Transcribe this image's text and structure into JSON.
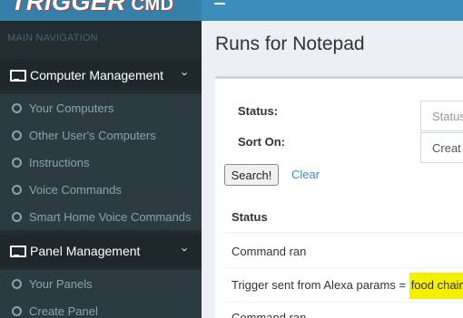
{
  "logo": {
    "text": "TRIGGER",
    "suffix": "CMD"
  },
  "sidebar": {
    "header": "MAIN NAVIGATION",
    "sections": [
      {
        "label": "Computer Management",
        "items": [
          "Your Computers",
          "Other User's Computers",
          "Instructions",
          "Voice Commands",
          "Smart Home Voice Commands"
        ]
      },
      {
        "label": "Panel Management",
        "items": [
          "Your Panels",
          "Create Panel"
        ]
      }
    ]
  },
  "page": {
    "title": "Runs for Notepad"
  },
  "filters": {
    "status_label": "Status:",
    "status_placeholder": "Status",
    "sort_label": "Sort On:",
    "sort_value": "Creat",
    "search_label": "Search!",
    "clear_label": "Clear"
  },
  "table": {
    "header": "Status",
    "rows": [
      {
        "prefix": "Command ran",
        "highlight": ""
      },
      {
        "prefix": "Trigger sent from Alexa params = ",
        "highlight": "food chain"
      },
      {
        "prefix": "Command ran",
        "highlight": ""
      }
    ]
  },
  "colors": {
    "sidebar": "#222d32",
    "topbar": "#3c8dbc",
    "highlight": "#f5ef00",
    "link": "#3c8dbc"
  }
}
